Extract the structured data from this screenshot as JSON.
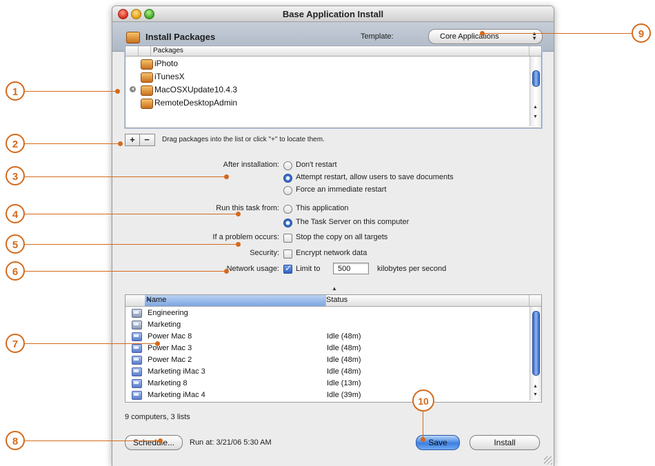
{
  "window": {
    "title": "Base Application Install",
    "header_title": "Install Packages",
    "template_label": "Template:",
    "template_value": "Core Applications"
  },
  "packages": {
    "column_header": "Packages",
    "items": [
      "iPhoto",
      "iTunesX",
      "MacOSXUpdate10.4.3",
      "RemoteDesktopAdmin"
    ],
    "add_label": "+",
    "remove_label": "−",
    "hint": "Drag packages into the list or click \"+\" to locate them."
  },
  "options": {
    "after_install_label": "After installation:",
    "after_install_choices": [
      "Don't restart",
      "Attempt restart, allow users to save documents",
      "Force an immediate restart"
    ],
    "after_install_selected": 1,
    "run_from_label": "Run this task from:",
    "run_from_choices": [
      "This application",
      "The Task Server on this computer"
    ],
    "run_from_selected": 1,
    "problem_label": "If a problem occurs:",
    "problem_option": "Stop the copy on all targets",
    "security_label": "Security:",
    "security_option": "Encrypt network data",
    "network_label": "Network usage:",
    "network_option": "Limit to",
    "network_value": "500",
    "network_unit": "kilobytes per second"
  },
  "computers": {
    "columns": [
      "Name",
      "Status"
    ],
    "rows": [
      {
        "name": "Engineering",
        "status": "",
        "kind": "list"
      },
      {
        "name": "Marketing",
        "status": "",
        "kind": "list"
      },
      {
        "name": "Power Mac 8",
        "status": "Idle (48m)",
        "kind": "computer"
      },
      {
        "name": "Power Mac 3",
        "status": "Idle (48m)",
        "kind": "computer"
      },
      {
        "name": "Power Mac 2",
        "status": "Idle (48m)",
        "kind": "computer"
      },
      {
        "name": "Marketing iMac 3",
        "status": "Idle (48m)",
        "kind": "computer"
      },
      {
        "name": "Marketing 8",
        "status": "Idle (13m)",
        "kind": "computer"
      },
      {
        "name": "Marketing iMac 4",
        "status": "Idle (39m)",
        "kind": "computer"
      }
    ],
    "summary": "9 computers, 3 lists"
  },
  "footer": {
    "schedule_label": "Schedule...",
    "run_at": "Run at: 3/21/06 5:30 AM",
    "save_label": "Save",
    "install_label": "Install"
  },
  "callouts": [
    "1",
    "2",
    "3",
    "4",
    "5",
    "6",
    "7",
    "8",
    "9",
    "10"
  ],
  "colors": {
    "callout": "#d46a1c",
    "selection": "#3c7fe0"
  }
}
